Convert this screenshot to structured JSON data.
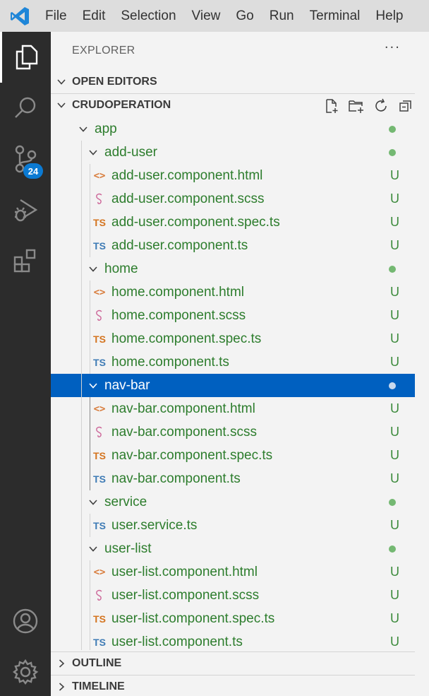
{
  "menubar": {
    "logo_icon": "vscode-logo-icon",
    "items": [
      "File",
      "Edit",
      "Selection",
      "View",
      "Go",
      "Run",
      "Terminal",
      "Help"
    ]
  },
  "activitybar": {
    "items": [
      "explorer-icon",
      "search-icon",
      "source-control-icon",
      "run-debug-icon",
      "extensions-icon"
    ],
    "source_control_badge": "24",
    "bottom": [
      "account-icon",
      "settings-gear-icon"
    ]
  },
  "sidebar": {
    "title": "EXPLORER",
    "more": "···",
    "open_editors": "OPEN EDITORS",
    "project": "CRUDOPERATION",
    "outline": "OUTLINE",
    "timeline": "TIMELINE",
    "tree": [
      {
        "label": "app",
        "kind": "folder",
        "depth": 0,
        "status": "dot"
      },
      {
        "label": "add-user",
        "kind": "folder",
        "depth": 1,
        "status": "dot"
      },
      {
        "label": "add-user.component.html",
        "kind": "html",
        "depth": 2,
        "status": "U"
      },
      {
        "label": "add-user.component.scss",
        "kind": "scss",
        "depth": 2,
        "status": "U"
      },
      {
        "label": "add-user.component.spec.ts",
        "kind": "spec",
        "depth": 2,
        "status": "U"
      },
      {
        "label": "add-user.component.ts",
        "kind": "ts",
        "depth": 2,
        "status": "U"
      },
      {
        "label": "home",
        "kind": "folder",
        "depth": 1,
        "status": "dot"
      },
      {
        "label": "home.component.html",
        "kind": "html",
        "depth": 2,
        "status": "U"
      },
      {
        "label": "home.component.scss",
        "kind": "scss",
        "depth": 2,
        "status": "U"
      },
      {
        "label": "home.component.spec.ts",
        "kind": "spec",
        "depth": 2,
        "status": "U"
      },
      {
        "label": "home.component.ts",
        "kind": "ts",
        "depth": 2,
        "status": "U"
      },
      {
        "label": "nav-bar",
        "kind": "folder",
        "depth": 1,
        "status": "dot",
        "selected": true
      },
      {
        "label": "nav-bar.component.html",
        "kind": "html",
        "depth": 2,
        "status": "U"
      },
      {
        "label": "nav-bar.component.scss",
        "kind": "scss",
        "depth": 2,
        "status": "U"
      },
      {
        "label": "nav-bar.component.spec.ts",
        "kind": "spec",
        "depth": 2,
        "status": "U"
      },
      {
        "label": "nav-bar.component.ts",
        "kind": "ts",
        "depth": 2,
        "status": "U"
      },
      {
        "label": "service",
        "kind": "folder",
        "depth": 1,
        "status": "dot"
      },
      {
        "label": "user.service.ts",
        "kind": "ts",
        "depth": 2,
        "status": "U"
      },
      {
        "label": "user-list",
        "kind": "folder",
        "depth": 1,
        "status": "dot"
      },
      {
        "label": "user-list.component.html",
        "kind": "html",
        "depth": 2,
        "status": "U"
      },
      {
        "label": "user-list.component.scss",
        "kind": "scss",
        "depth": 2,
        "status": "U"
      },
      {
        "label": "user-list.component.spec.ts",
        "kind": "spec",
        "depth": 2,
        "status": "U"
      },
      {
        "label": "user-list.component.ts",
        "kind": "ts",
        "depth": 2,
        "status": "U"
      }
    ],
    "icon_glyphs": {
      "html": "<>",
      "ts": "TS",
      "spec": "TS"
    },
    "colors": {
      "accent": "#0060c0",
      "untracked": "#2d7d2d",
      "html_icon": "#d87b3a",
      "ts_icon": "#3e7bb5",
      "spec_icon": "#d4741f",
      "scss_icon": "#cd6799"
    }
  }
}
